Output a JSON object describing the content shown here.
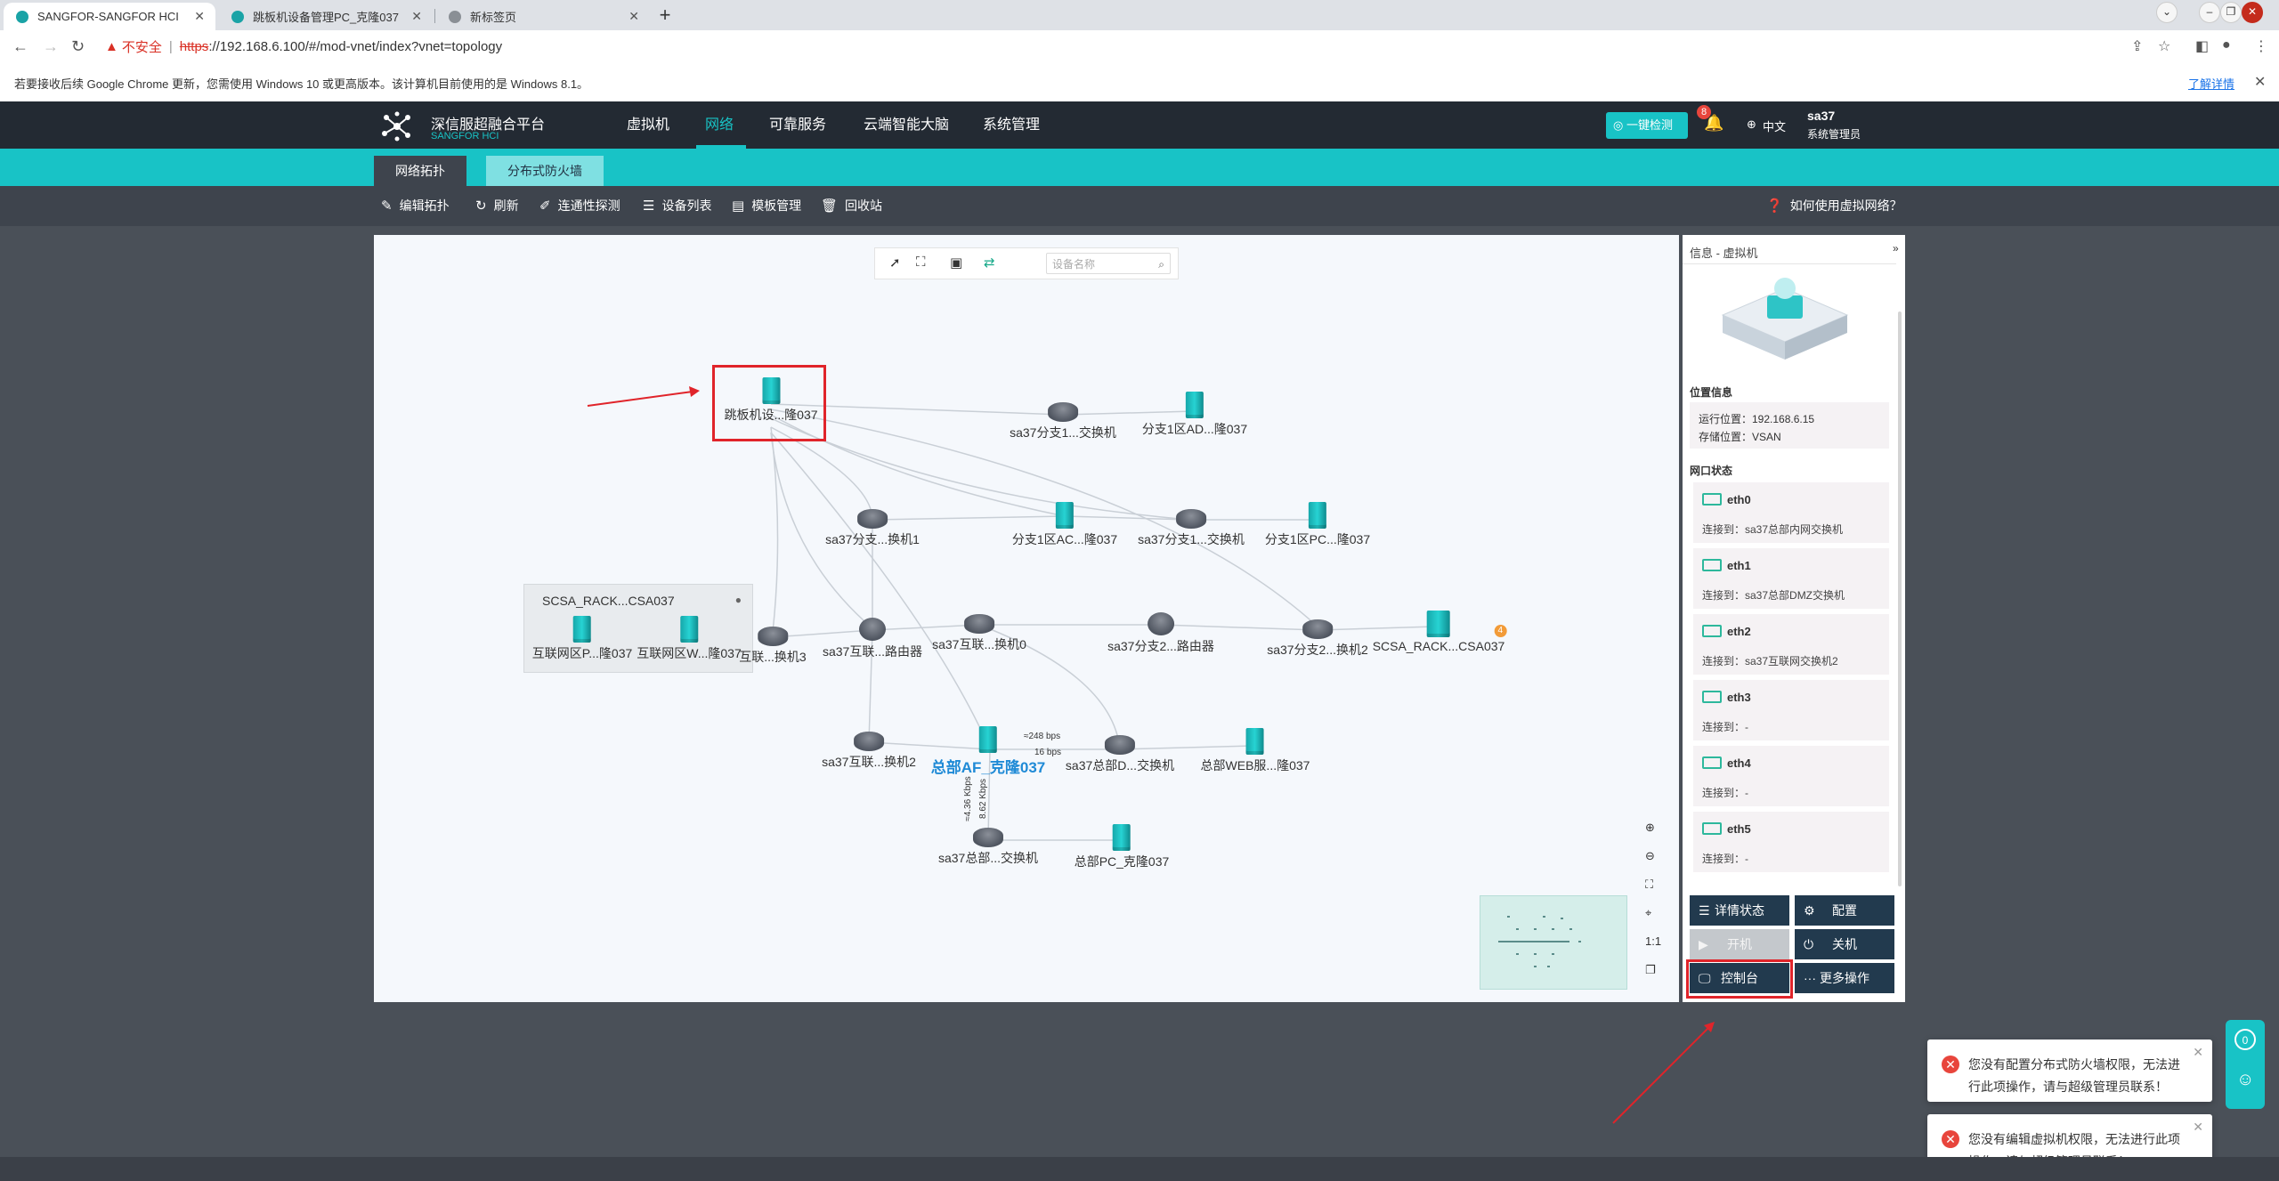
{
  "browser": {
    "tabs": [
      {
        "title": "SANGFOR-SANGFOR HCI"
      },
      {
        "title": "跳板机设备管理PC_克隆037"
      },
      {
        "title": "新标签页"
      }
    ],
    "security": "不安全",
    "url_scheme": "https",
    "url_rest": "://192.168.6.100/#/mod-vnet/index?vnet=topology",
    "info_message": "若要接收后续 Google Chrome 更新，您需使用 Windows 10 或更高版本。该计算机目前使用的是 Windows 8.1。",
    "info_link": "了解详情"
  },
  "app": {
    "logo_title": "深信服超融合平台",
    "logo_sub": "SANGFOR HCI",
    "nav": [
      "虚拟机",
      "网络",
      "可靠服务",
      "云端智能大脑",
      "系统管理"
    ],
    "active_nav": "网络",
    "one_click": "一键检测",
    "bell_count": "8",
    "lang": "中文",
    "user_name": "sa37",
    "user_role": "系统管理员"
  },
  "subnav": {
    "tabs": [
      "网络拓扑",
      "分布式防火墙"
    ]
  },
  "toolbar": {
    "items": [
      "编辑拓扑",
      "刷新",
      "连通性探测",
      "设备列表",
      "模板管理",
      "回收站"
    ],
    "help": "如何使用虚拟网络？"
  },
  "canvas": {
    "search_placeholder": "设备名称",
    "group_title": "SCSA_RACK...CSA037",
    "nodes": [
      "跳板机设...隆037",
      "sa37分支1...交换机",
      "分支1区AD...隆037",
      "sa37分支...换机1",
      "分支1区AC...隆037",
      "sa37分支1...交换机",
      "分支1区PC...隆037",
      "互联网区P...隆037",
      "互联网区W...隆037",
      "互联...换机3",
      "sa37互联...路由器",
      "sa37互联...换机0",
      "sa37分支2...路由器",
      "sa37分支2...换机2",
      "SCSA_RACK...CSA037",
      "sa37互联...换机2",
      "总部AF_克隆037",
      "sa37总部D...交换机",
      "总部WEB服...隆037",
      "sa37总部...交换机",
      "总部PC_克隆037"
    ],
    "badge": "4",
    "traffic": [
      "≈248 bps",
      "16 bps",
      "≈4.36 Kbps",
      "8.62 Kbps"
    ],
    "zoom_ratio": "1:1"
  },
  "panel": {
    "header": "信息 - 虚拟机",
    "location_title": "位置信息",
    "run_location": "运行位置：192.168.6.15",
    "storage_location": "存储位置：VSAN",
    "ports_title": "网口状态",
    "ports": [
      {
        "name": "eth0",
        "conn": "连接到：sa37总部内网交换机"
      },
      {
        "name": "eth1",
        "conn": "连接到：sa37总部DMZ交换机"
      },
      {
        "name": "eth2",
        "conn": "连接到：sa37互联网交换机2"
      },
      {
        "name": "eth3",
        "conn": "连接到：-"
      },
      {
        "name": "eth4",
        "conn": "连接到：-"
      },
      {
        "name": "eth5",
        "conn": "连接到：-"
      }
    ],
    "buttons": [
      "详情状态",
      "配置",
      "开机",
      "关机",
      "控制台",
      "更多操作"
    ]
  },
  "toasts": [
    "您没有配置分布式防火墙权限，无法进行此项操作，请与超级管理员联系！",
    "您没有编辑虚拟机权限，无法进行此项操作，请与超级管理员联系！"
  ],
  "float_badge": "0"
}
